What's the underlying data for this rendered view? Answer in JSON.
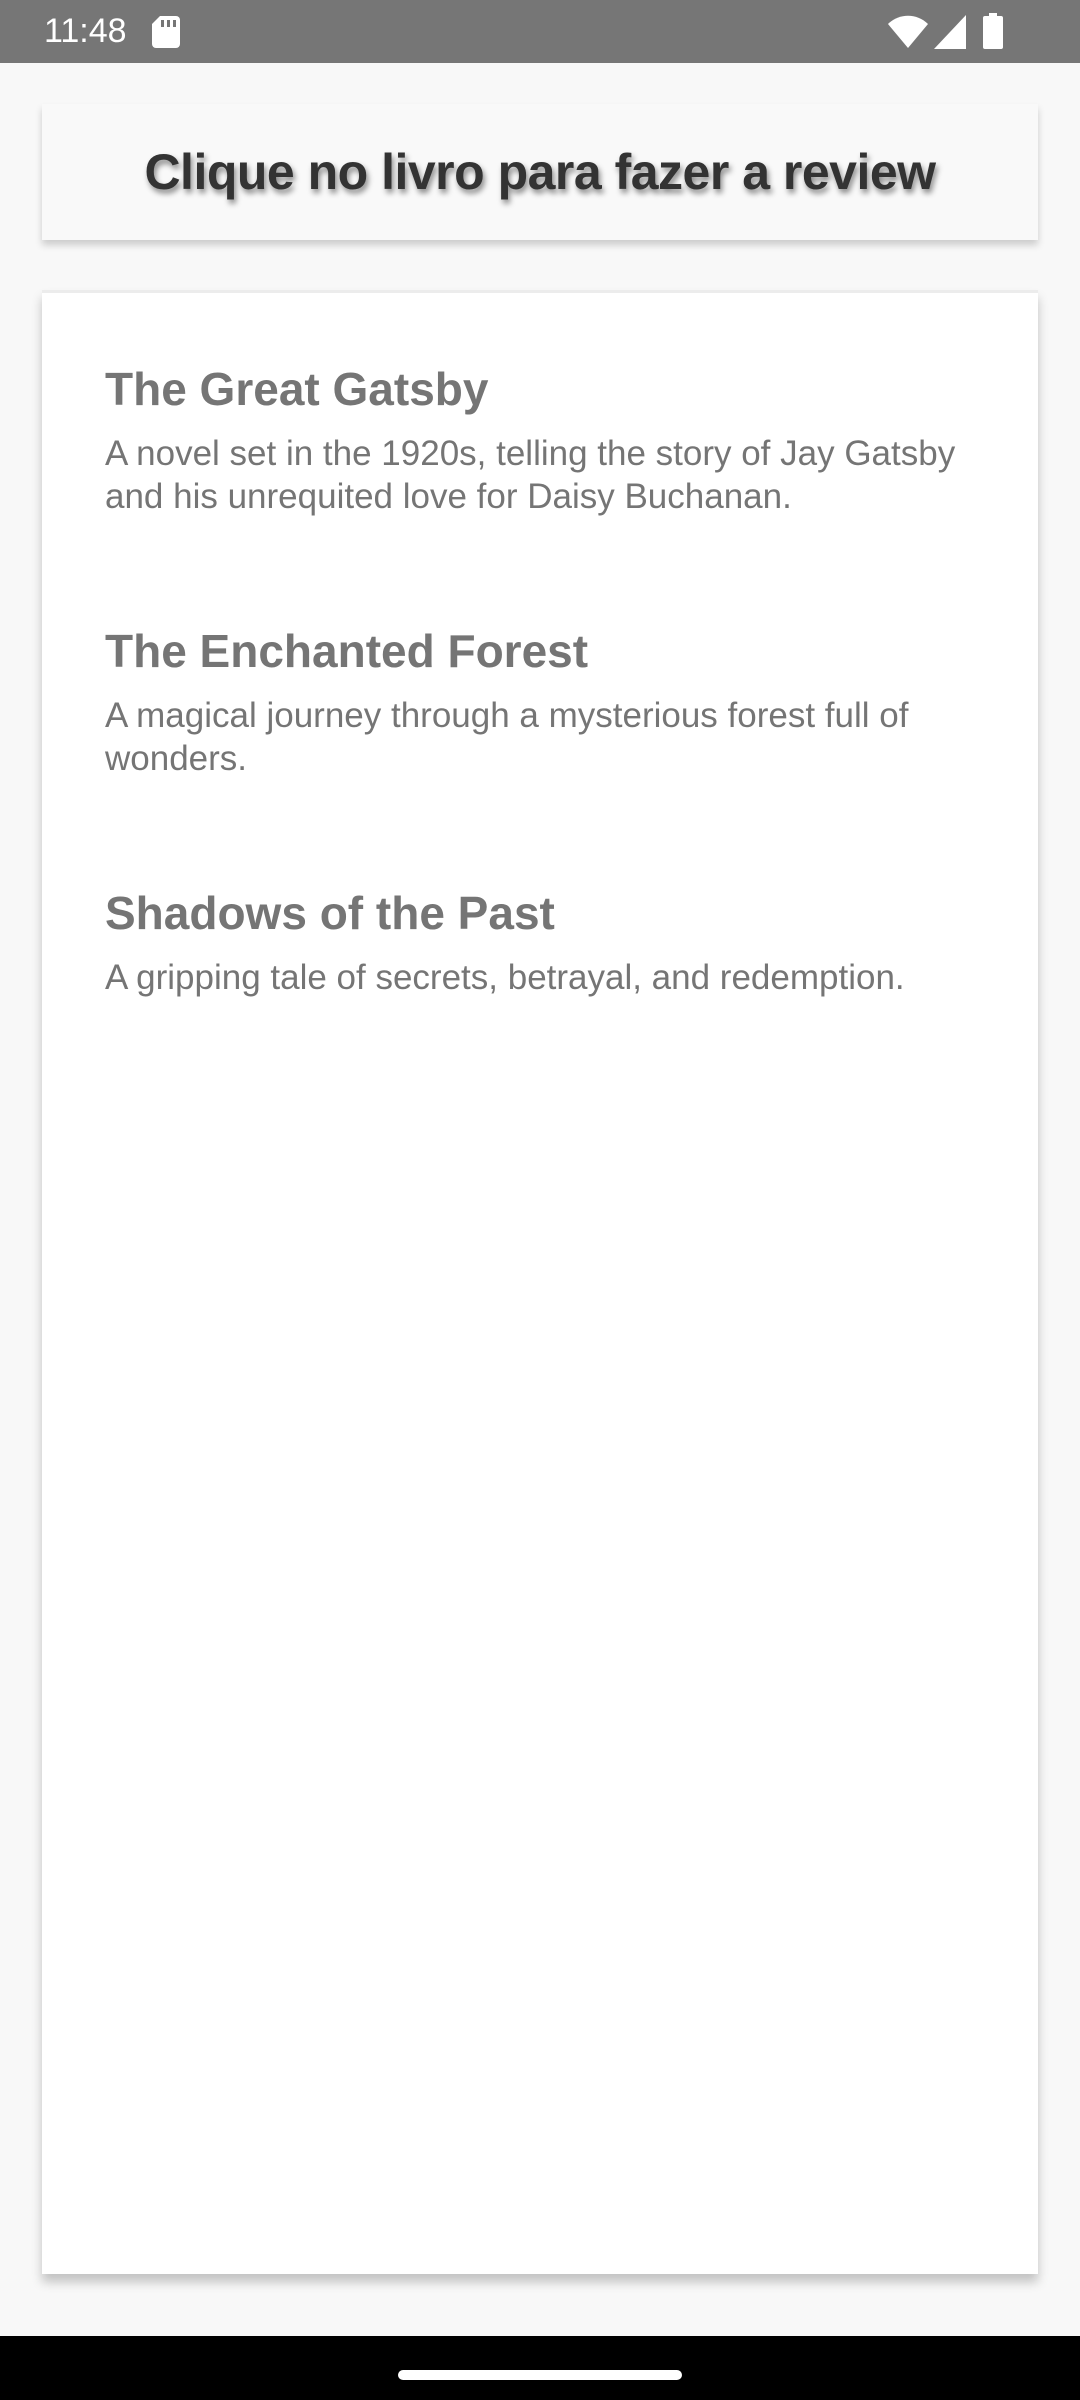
{
  "status_bar": {
    "time": "11:48",
    "icons": [
      "sd-card-icon",
      "wifi-icon",
      "signal-icon",
      "battery-icon"
    ]
  },
  "header": {
    "title": "Clique no livro para fazer a review"
  },
  "books": [
    {
      "title": "The Great Gatsby",
      "description": "A novel set in the 1920s, telling the story of Jay Gatsby and his unrequited love for Daisy Buchanan."
    },
    {
      "title": "The Enchanted Forest",
      "description": "A magical journey through a mysterious forest full of wonders."
    },
    {
      "title": "Shadows of the Past",
      "description": "A gripping tale of secrets, betrayal, and redemption."
    }
  ],
  "colors": {
    "status_bar_bg": "#767676",
    "page_bg": "#f8f8f8",
    "card_bg": "#ffffff",
    "text_gray": "#757575",
    "header_text": "#333333",
    "nav_bar_bg": "#000000"
  }
}
